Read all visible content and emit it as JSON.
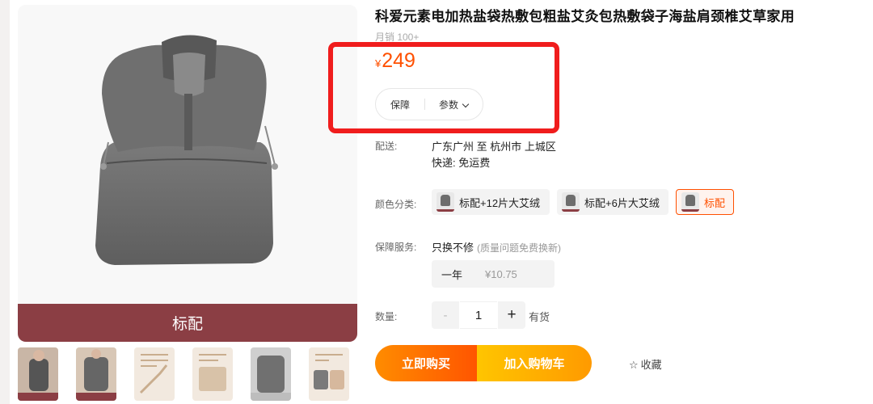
{
  "product": {
    "title": "科爱元素电加热盐袋热敷包粗盐艾灸包热敷袋子海盐肩颈椎艾草家用",
    "sales": "月销 100+",
    "currency": "¥",
    "price": "249",
    "variant_band": "标配"
  },
  "pill": {
    "guarantee": "保障",
    "params": "参数"
  },
  "shipping": {
    "label": "配送:",
    "route": "广东广州 至 杭州市 上城区",
    "method": "快递: 免运费"
  },
  "color": {
    "label": "颜色分类:",
    "options": [
      "标配+12片大艾绒",
      "标配+6片大艾绒",
      "标配"
    ]
  },
  "service": {
    "label": "保障服务:",
    "name": "只换不修",
    "note": "(质量问题免费换新)",
    "plan": "一年",
    "fee": "¥10.75"
  },
  "quantity": {
    "label": "数量:",
    "minus": "-",
    "value": "1",
    "plus": "+",
    "stock": "有货"
  },
  "actions": {
    "buy": "立即购买",
    "cart": "加入购物车",
    "favorite": "收藏"
  },
  "icons": {
    "chevron": "chevron-down-icon",
    "star": "star-outline-icon"
  },
  "colors": {
    "accent": "#ff5000",
    "highlight": "#f01d1d",
    "band": "#8b3e44"
  }
}
